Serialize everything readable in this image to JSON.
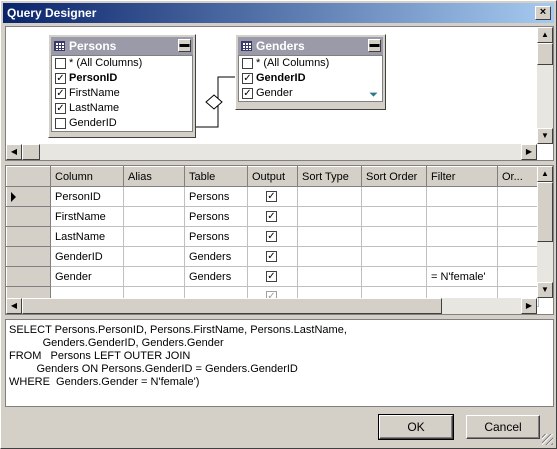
{
  "window": {
    "title": "Query Designer",
    "close_glyph": "×"
  },
  "diagram": {
    "tables": [
      {
        "name": "Persons",
        "minimize_glyph": "▬",
        "columns": [
          {
            "label": "* (All Columns)",
            "checked": false,
            "bold": false
          },
          {
            "label": "PersonID",
            "checked": true,
            "bold": true
          },
          {
            "label": "FirstName",
            "checked": true,
            "bold": false
          },
          {
            "label": "LastName",
            "checked": true,
            "bold": false
          },
          {
            "label": "GenderID",
            "checked": false,
            "bold": false
          }
        ]
      },
      {
        "name": "Genders",
        "minimize_glyph": "▬",
        "columns": [
          {
            "label": "* (All Columns)",
            "checked": false,
            "bold": false
          },
          {
            "label": "GenderID",
            "checked": true,
            "bold": true
          },
          {
            "label": "Gender",
            "checked": true,
            "bold": false,
            "filtered": true
          }
        ]
      }
    ]
  },
  "grid": {
    "headers": [
      "Column",
      "Alias",
      "Table",
      "Output",
      "Sort Type",
      "Sort Order",
      "Filter",
      "Or..."
    ],
    "rows": [
      {
        "current": true,
        "column": "PersonID",
        "alias": "",
        "table": "Persons",
        "output": true,
        "sort_type": "",
        "sort_order": "",
        "filter": "",
        "or": ""
      },
      {
        "current": false,
        "column": "FirstName",
        "alias": "",
        "table": "Persons",
        "output": true,
        "sort_type": "",
        "sort_order": "",
        "filter": "",
        "or": ""
      },
      {
        "current": false,
        "column": "LastName",
        "alias": "",
        "table": "Persons",
        "output": true,
        "sort_type": "",
        "sort_order": "",
        "filter": "",
        "or": ""
      },
      {
        "current": false,
        "column": "GenderID",
        "alias": "",
        "table": "Genders",
        "output": true,
        "sort_type": "",
        "sort_order": "",
        "filter": "",
        "or": ""
      },
      {
        "current": false,
        "column": "Gender",
        "alias": "",
        "table": "Genders",
        "output": true,
        "sort_type": "",
        "sort_order": "",
        "filter": "= N'female'",
        "or": ""
      },
      {
        "current": false,
        "column": "",
        "alias": "",
        "table": "",
        "output": "dim",
        "sort_type": "",
        "sort_order": "",
        "filter": "",
        "or": ""
      }
    ]
  },
  "sql": {
    "text": "SELECT Persons.PersonID, Persons.FirstName, Persons.LastName,\n           Genders.GenderID, Genders.Gender\nFROM   Persons LEFT OUTER JOIN\n         Genders ON Persons.GenderID = Genders.GenderID\nWHERE  Genders.Gender = N'female')"
  },
  "buttons": {
    "ok": "OK",
    "cancel": "Cancel"
  },
  "icons": {
    "check": "✓",
    "scroll_up": "▲",
    "scroll_down": "▼",
    "scroll_left": "◀",
    "scroll_right": "▶",
    "filter": "⏷"
  }
}
